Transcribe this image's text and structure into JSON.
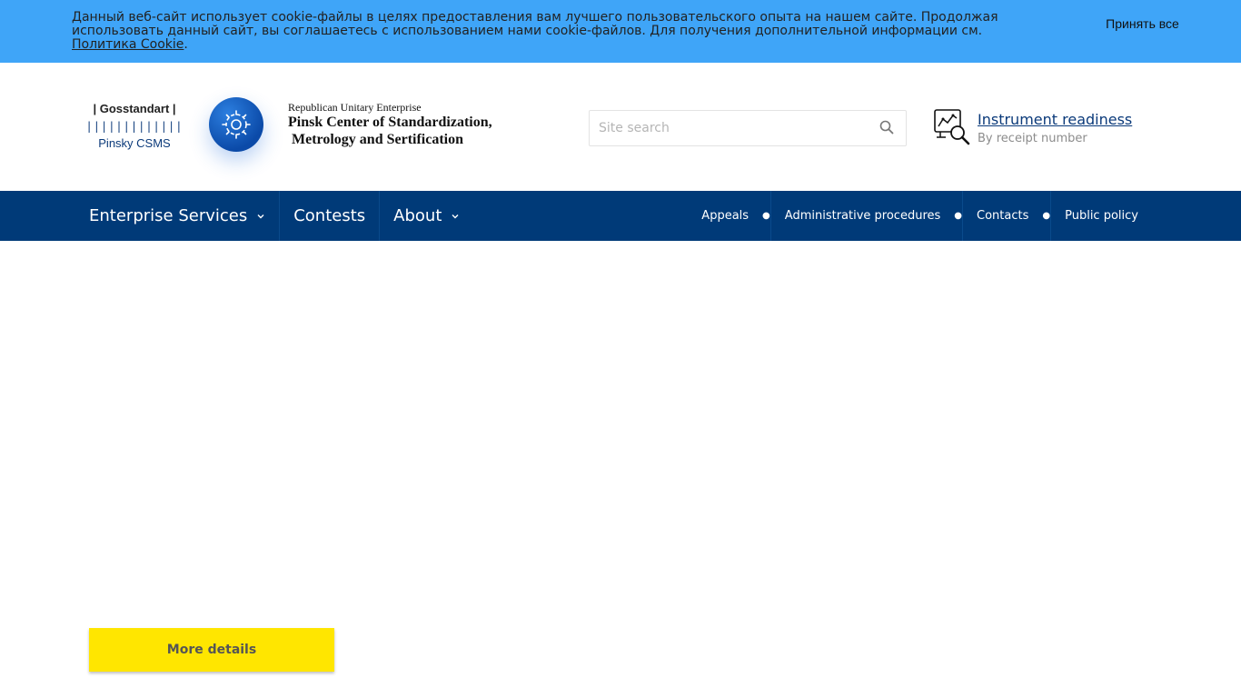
{
  "cookie_banner": {
    "message": "Данный веб-сайт использует cookie-файлы в целях предоставления вам лучшего пользовательского опыта на нашем сайте. Продолжая использовать данный сайт, вы соглашаетесь с использованием нами cookie-файлов. Для получения дополнительной информации см.",
    "policy_link": "Политика Cookie",
    "period": ".",
    "accept_label": "Принять все",
    "background_color": "#3fa5f8"
  },
  "brand": {
    "top": "| Gosstandart |",
    "bars": "|||||||||||||",
    "sub": "Pinsky CSMS"
  },
  "logo": {
    "icon": "gear-with-circuit-icon",
    "line1": "Republican Unitary Enterprise",
    "line2": "Pinsk Center of Standardization,",
    "line3": "Metrology and Sertification"
  },
  "search": {
    "placeholder": "Site search",
    "icon": "search-icon"
  },
  "readiness": {
    "icon": "chart-magnifier-icon",
    "link": "Instrument readiness",
    "sub": "By receipt number"
  },
  "nav": {
    "background_color": "#003a78",
    "main": [
      {
        "label": "Enterprise Services",
        "has_dropdown": true
      },
      {
        "label": "Contests",
        "has_dropdown": false
      },
      {
        "label": "About",
        "has_dropdown": true
      }
    ],
    "secondary": [
      "Appeals",
      "Administrative procedures",
      "Contacts",
      "Public policy"
    ]
  },
  "more_details": {
    "label": "More details",
    "color": "#ffe600"
  }
}
